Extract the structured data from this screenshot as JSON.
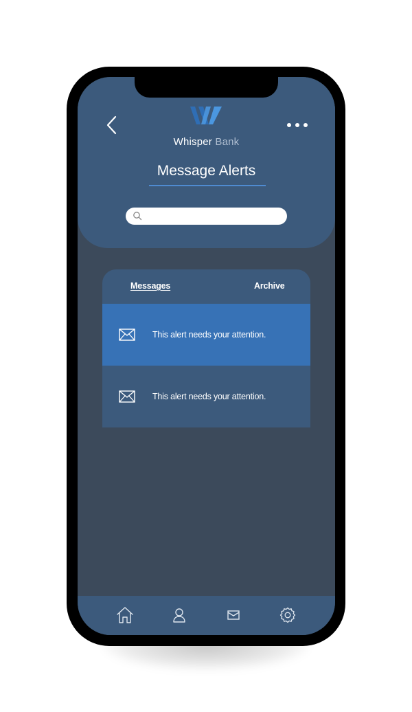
{
  "app": {
    "brand_primary": "Whisper",
    "brand_secondary": "Bank",
    "page_title": "Message Alerts"
  },
  "search": {
    "placeholder": "",
    "value": ""
  },
  "tabs": [
    {
      "label": "Messages",
      "active": true
    },
    {
      "label": "Archive",
      "active": false
    }
  ],
  "alerts": [
    {
      "text": "This alert needs your attention.",
      "icon": "mail-icon",
      "highlighted": true
    },
    {
      "text": "This alert needs your attention.",
      "icon": "mail-icon",
      "highlighted": false
    }
  ],
  "bottom_nav": [
    {
      "icon": "home-icon"
    },
    {
      "icon": "profile-icon"
    },
    {
      "icon": "mail-icon"
    },
    {
      "icon": "settings-icon"
    }
  ],
  "colors": {
    "header_bg": "#3c5a7c",
    "screen_bg": "#3c4a5b",
    "highlight_row": "#3772b6",
    "accent_line": "#4f8bd1"
  }
}
